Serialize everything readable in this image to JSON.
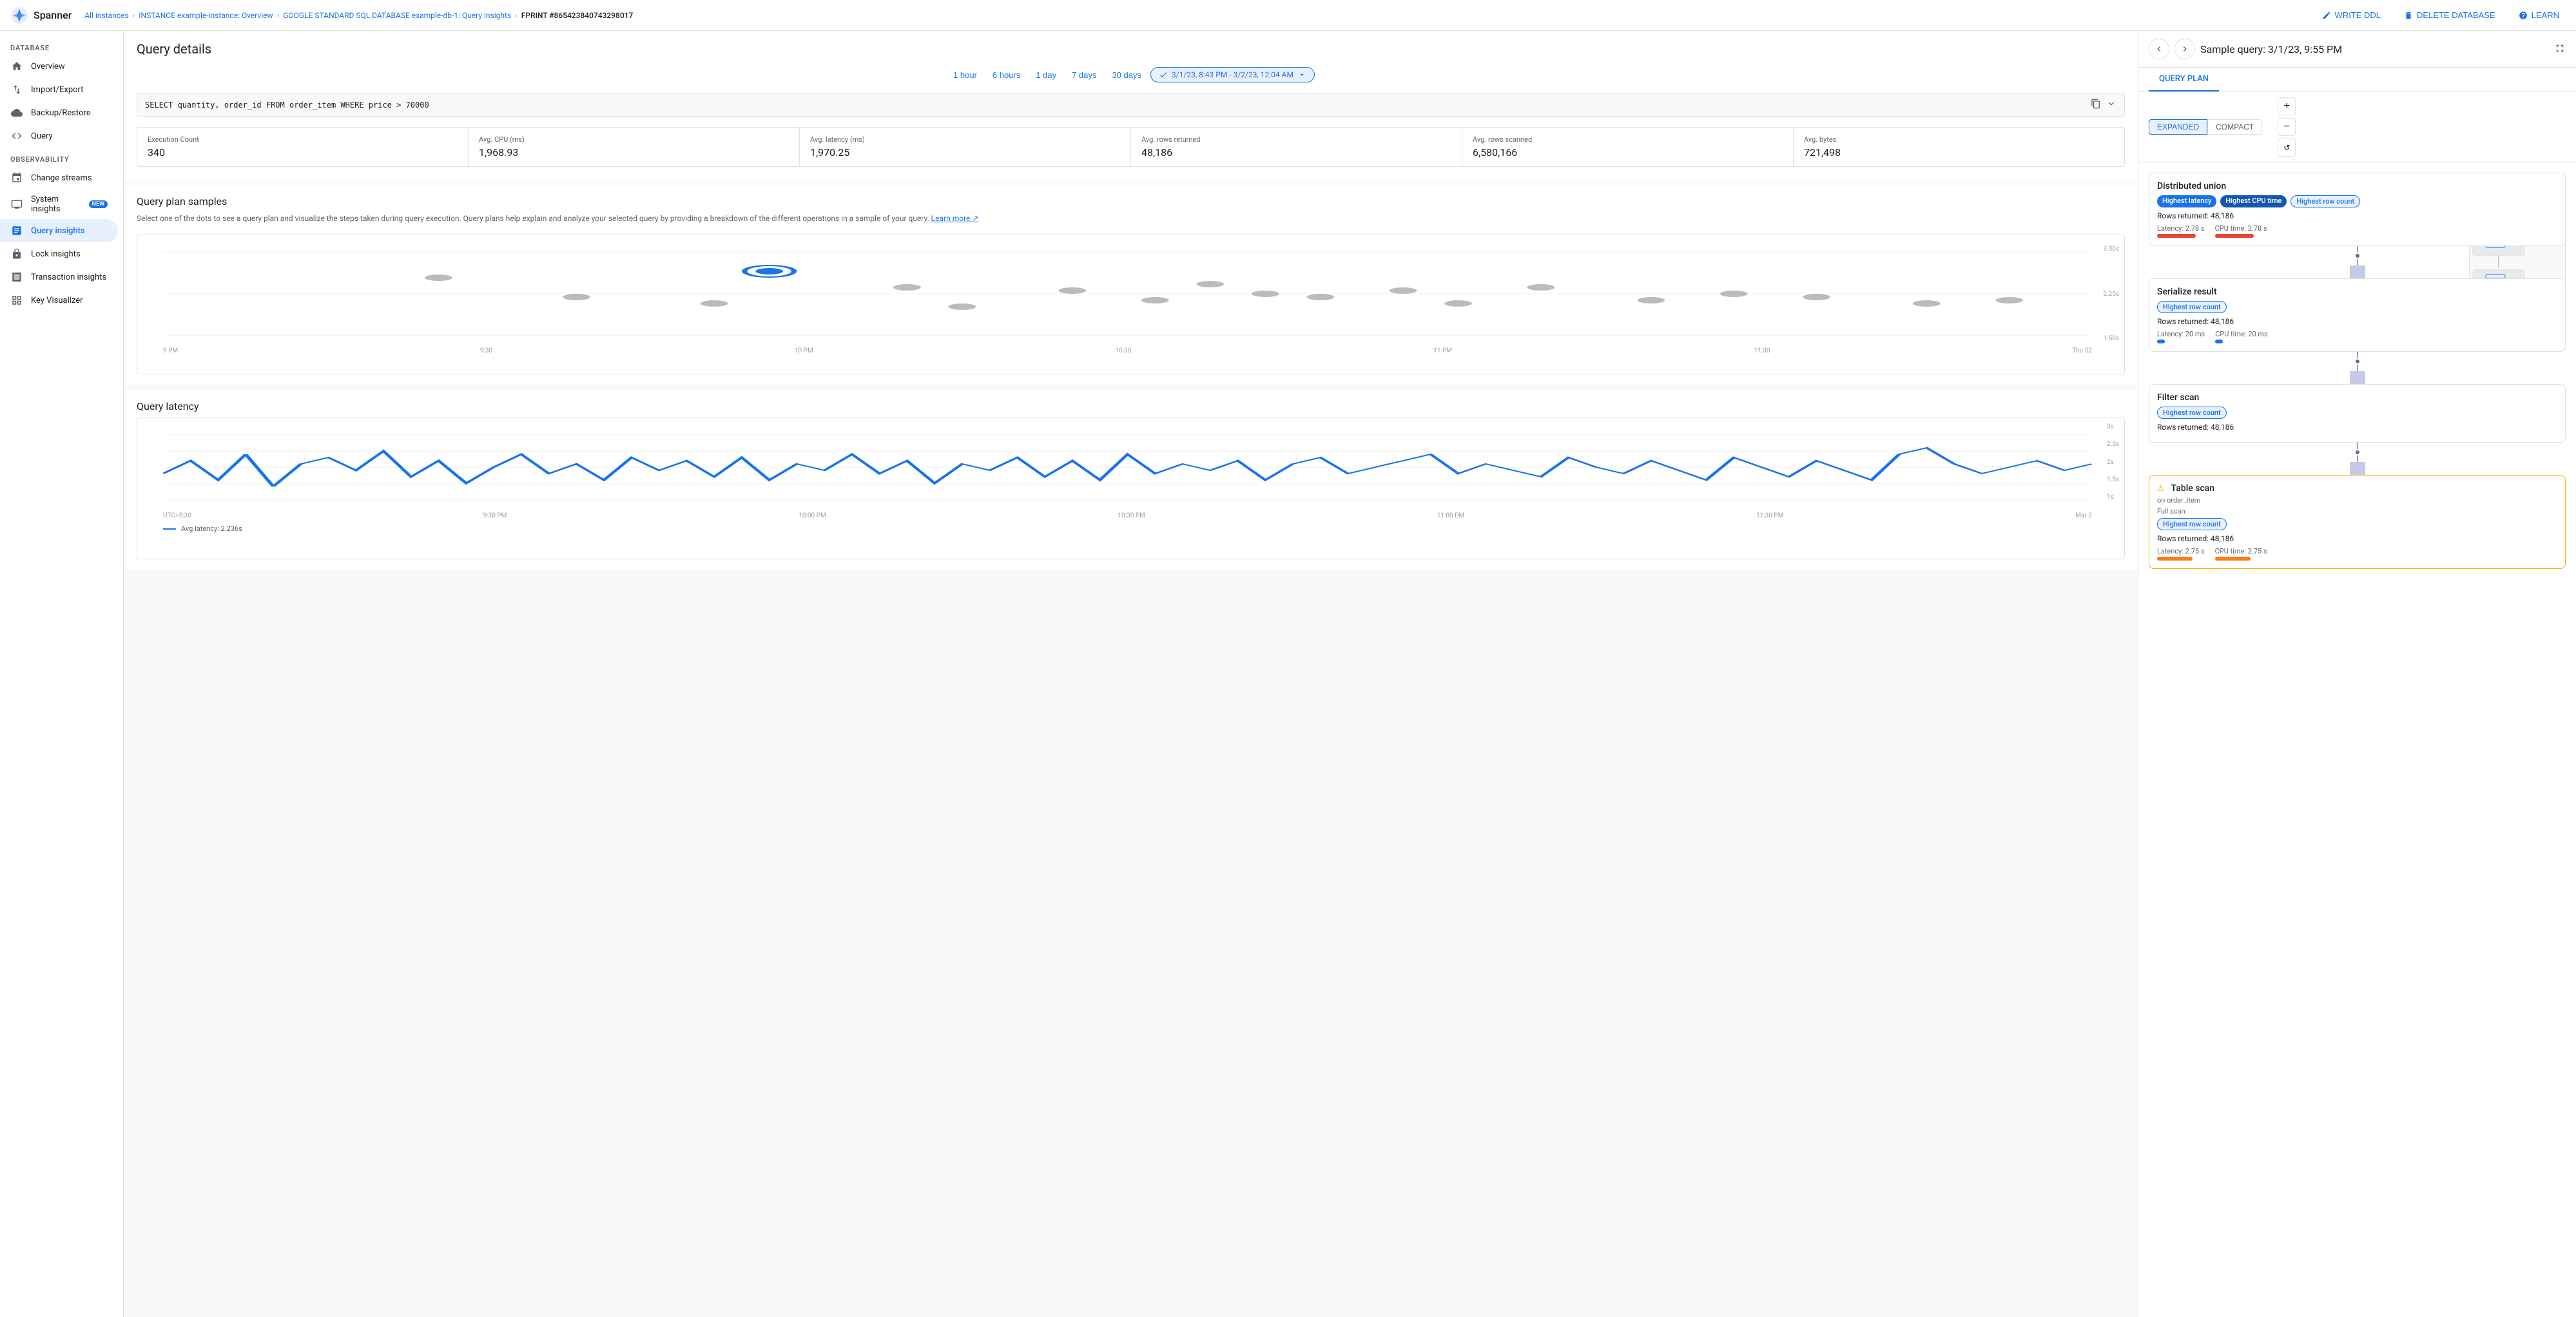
{
  "app": {
    "name": "Spanner"
  },
  "breadcrumb": {
    "items": [
      {
        "label": "All instances",
        "href": "#"
      },
      {
        "label": "INSTANCE example-instance: Overview",
        "href": "#"
      },
      {
        "label": "GOOGLE STANDARD SQL DATABASE example-db-1: Query insights",
        "href": "#"
      },
      {
        "label": "FPRINT #865423840743298017",
        "href": "#",
        "current": true
      }
    ]
  },
  "top_actions": {
    "write_ddl": "WRITE DDL",
    "delete_database": "DELETE DATABASE",
    "learn": "LEARN"
  },
  "sidebar": {
    "database_label": "DATABASE",
    "observability_label": "OBSERVABILITY",
    "db_items": [
      {
        "id": "overview",
        "label": "Overview",
        "icon": "home"
      },
      {
        "id": "import-export",
        "label": "Import/Export",
        "icon": "swap"
      },
      {
        "id": "backup-restore",
        "label": "Backup/Restore",
        "icon": "backup"
      },
      {
        "id": "query",
        "label": "Query",
        "icon": "code"
      }
    ],
    "obs_items": [
      {
        "id": "change-streams",
        "label": "Change streams",
        "icon": "stream"
      },
      {
        "id": "system-insights",
        "label": "System insights",
        "icon": "monitor",
        "badge": "NEW"
      },
      {
        "id": "query-insights",
        "label": "Query insights",
        "icon": "insights",
        "active": true
      },
      {
        "id": "lock-insights",
        "label": "Lock insights",
        "icon": "lock"
      },
      {
        "id": "transaction-insights",
        "label": "Transaction insights",
        "icon": "receipt"
      },
      {
        "id": "key-visualizer",
        "label": "Key Visualizer",
        "icon": "grid"
      }
    ]
  },
  "query_details": {
    "title": "Query details",
    "time_filters": [
      "1 hour",
      "6 hours",
      "1 day",
      "7 days",
      "30 days"
    ],
    "date_range": "3/1/23, 8:43 PM - 3/2/23, 12:04 AM",
    "query_text": "SELECT quantity, order_id FROM order_item WHERE price > 70000",
    "stats": [
      {
        "label": "Execution Count",
        "value": "340"
      },
      {
        "label": "Avg. CPU (ms)",
        "value": "1,968.93"
      },
      {
        "label": "Avg. latency (ms)",
        "value": "1,970.25"
      },
      {
        "label": "Avg. rows returned",
        "value": "48,186"
      },
      {
        "label": "Avg. rows scanned",
        "value": "6,580,166"
      },
      {
        "label": "Avg. bytes",
        "value": "721,498"
      }
    ]
  },
  "query_plan_samples": {
    "title": "Query plan samples",
    "description": "Select one of the dots to see a query plan and visualize the steps taken during query execution. Query plans help explain and analyze your selected query by providing a breakdown of the different operations in a sample of your query.",
    "learn_more": "Learn more",
    "x_labels": [
      "9 PM",
      "9:30",
      "10 PM",
      "10:30",
      "11 PM",
      "11:30",
      "Thu 02"
    ],
    "y_labels": [
      "3.00s",
      "2.25s",
      "1.50s"
    ]
  },
  "query_latency": {
    "title": "Query latency",
    "x_labels": [
      "UTC+5:30",
      "9:30 PM",
      "10:00 PM",
      "10:30 PM",
      "11:00 PM",
      "11:30 PM",
      "Mar 2"
    ],
    "y_labels": [
      "3s",
      "2.5s",
      "2s",
      "1.5s",
      "1s"
    ],
    "legend": "Avg latency: 2.236s"
  },
  "right_panel": {
    "title": "Sample query: 3/1/23, 9:55 PM",
    "tab_query_plan": "QUERY PLAN",
    "view_expanded": "EXPANDED",
    "view_compact": "COMPACT",
    "nodes": [
      {
        "id": "distributed-union",
        "title": "Distributed union",
        "badges": [
          "Highest latency",
          "Highest CPU time",
          "Highest row count"
        ],
        "rows_returned": "Rows returned: 48,186",
        "latency": "Latency: 2.78 s",
        "cpu_time": "CPU time: 2.78 s",
        "bar_latency": "red-lg",
        "bar_cpu": "red-lg"
      },
      {
        "id": "serialize-result",
        "title": "Serialize result",
        "badges": [
          "Highest row count"
        ],
        "rows_returned": "Rows returned: 48,186",
        "latency": "Latency: 20 ms",
        "cpu_time": "CPU time: 20 ms",
        "bar_latency": "blue-sm",
        "bar_cpu": "blue-sm"
      },
      {
        "id": "filter-scan",
        "title": "Filter scan",
        "badges": [
          "Highest row count"
        ],
        "rows_returned": "Rows returned: 48,186",
        "latency": null,
        "cpu_time": null
      },
      {
        "id": "table-scan",
        "title": "Table scan",
        "subtitle": "on order_item",
        "detail": "Full scan",
        "badges": [
          "Highest row count"
        ],
        "rows_returned": "Rows returned: 48,186",
        "latency": "Latency: 2.75 s",
        "cpu_time": "CPU time: 2.75 s",
        "warn": true,
        "bar_latency": "orange",
        "bar_cpu": "orange"
      }
    ]
  }
}
